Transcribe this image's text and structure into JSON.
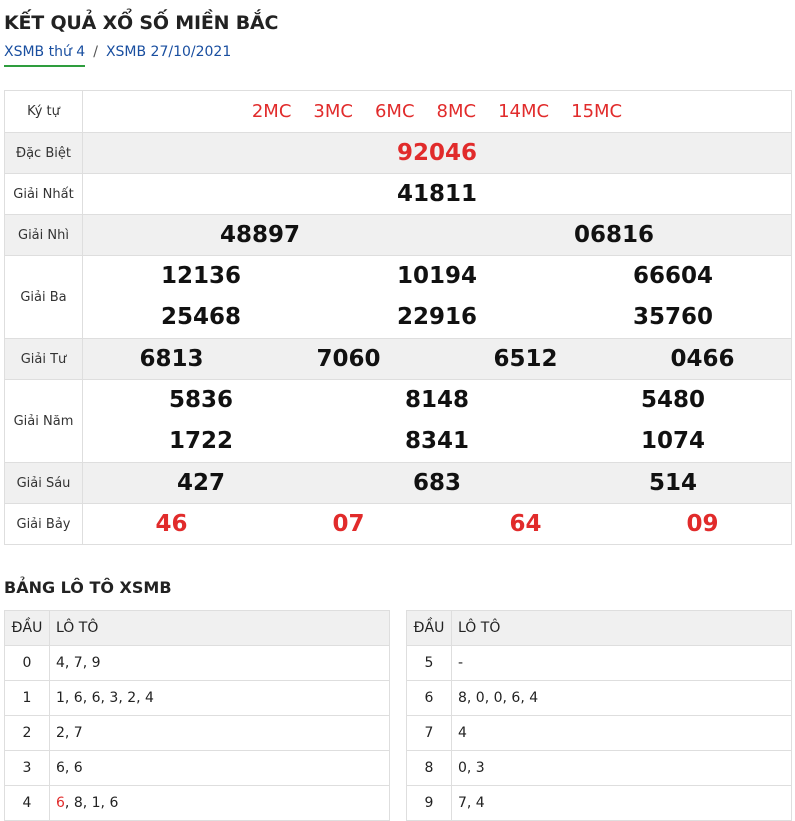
{
  "page_title": "KẾT QUẢ XỔ SỐ MIỀN BẮC",
  "breadcrumb": {
    "active": "XSMB thứ 4",
    "separator": "/",
    "current": "XSMB 27/10/2021"
  },
  "results": {
    "ky_tu": {
      "label": "Ký tự",
      "codes": [
        "2MC",
        "3MC",
        "6MC",
        "8MC",
        "14MC",
        "15MC"
      ]
    },
    "dac_biet": {
      "label": "Đặc Biệt",
      "numbers": [
        "92046"
      ]
    },
    "giai_nhat": {
      "label": "Giải Nhất",
      "numbers": [
        "41811"
      ]
    },
    "giai_nhi": {
      "label": "Giải Nhì",
      "numbers": [
        "48897",
        "06816"
      ]
    },
    "giai_ba": {
      "label": "Giải Ba",
      "numbers": [
        "12136",
        "10194",
        "66604",
        "25468",
        "22916",
        "35760"
      ]
    },
    "giai_tu": {
      "label": "Giải Tư",
      "numbers": [
        "6813",
        "7060",
        "6512",
        "0466"
      ]
    },
    "giai_nam": {
      "label": "Giải Năm",
      "numbers": [
        "5836",
        "8148",
        "5480",
        "1722",
        "8341",
        "1074"
      ]
    },
    "giai_sau": {
      "label": "Giải Sáu",
      "numbers": [
        "427",
        "683",
        "514"
      ]
    },
    "giai_bay": {
      "label": "Giải Bảy",
      "numbers": [
        "46",
        "07",
        "64",
        "09"
      ]
    }
  },
  "loto": {
    "title": "BẢNG LÔ TÔ XSMB",
    "col_dau": "ĐẦU",
    "col_loto": "LÔ TÔ",
    "left_rows": [
      {
        "dau": "0",
        "values": "4, 7, 9"
      },
      {
        "dau": "1",
        "values": "1, 6, 6, 3, 2, 4"
      },
      {
        "dau": "2",
        "values": "2, 7"
      },
      {
        "dau": "3",
        "values": "6, 6"
      },
      {
        "dau": "4",
        "highlight": "6",
        "rest": ", 8, 1, 6"
      }
    ],
    "right_rows": [
      {
        "dau": "5",
        "values": "-"
      },
      {
        "dau": "6",
        "values": "8, 0, 0, 6, 4"
      },
      {
        "dau": "7",
        "values": "4"
      },
      {
        "dau": "8",
        "values": "0, 3"
      },
      {
        "dau": "9",
        "values": "7, 4"
      }
    ]
  },
  "colors": {
    "accent_red": "#e12b2b",
    "link_blue": "#1a4fa0",
    "underline_green": "#2e9d3e",
    "row_alt_bg": "#f0f0f0"
  }
}
